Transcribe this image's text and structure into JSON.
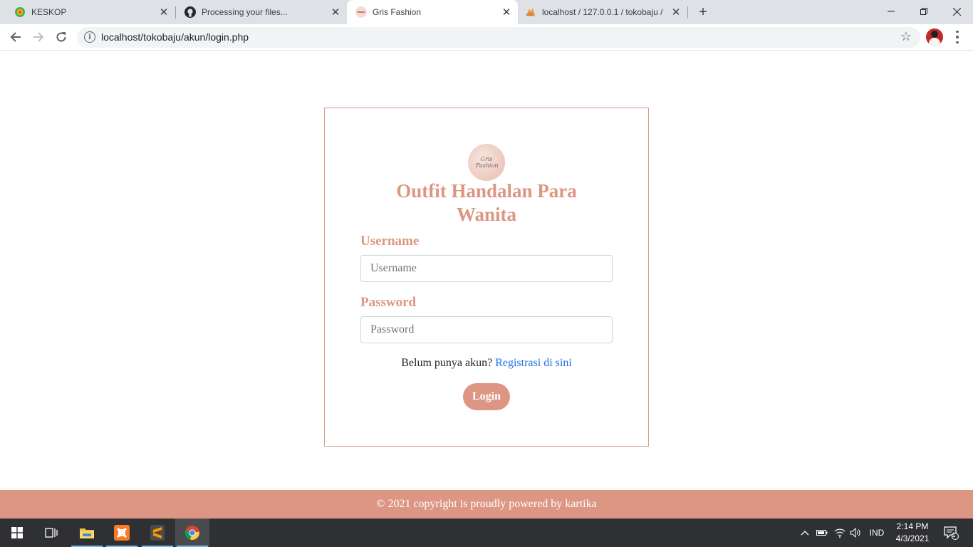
{
  "browser": {
    "tabs": [
      {
        "title": "KESKOP",
        "active": false
      },
      {
        "title": "Processing your files...",
        "active": false
      },
      {
        "title": "Gris Fashion",
        "active": true
      },
      {
        "title": "localhost / 127.0.0.1 / tokobaju /",
        "active": false
      }
    ],
    "url": "localhost/tokobaju/akun/login.php"
  },
  "page": {
    "logo_text": "Gris Fashion",
    "heading_line1": "Outfit Handalan Para",
    "heading_line2": "Wanita",
    "username_label": "Username",
    "username_placeholder": "Username",
    "username_value": "",
    "password_label": "Password",
    "password_placeholder": "Password",
    "password_value": "",
    "register_prompt": "Belum punya akun?",
    "register_link": "Registrasi di sini",
    "login_button": "Login",
    "footer": "© 2021 copyright is proudly powered by kartika",
    "accent_color": "#dc9683"
  },
  "taskbar": {
    "apps": [
      "start-icon",
      "task-view-icon",
      "file-explorer-icon",
      "xampp-icon",
      "sublime-text-icon",
      "chrome-icon"
    ],
    "language": "IND",
    "time": "2:14 PM",
    "date": "4/3/2021",
    "notification_count": "1"
  }
}
